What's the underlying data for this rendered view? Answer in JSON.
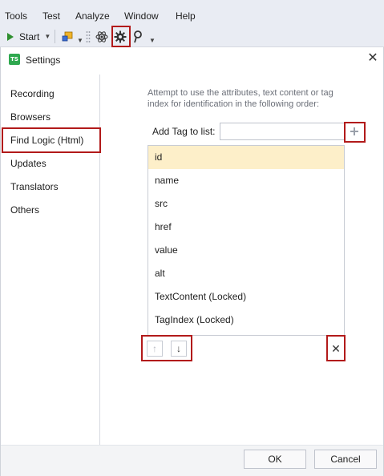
{
  "menu": {
    "items": [
      "Tools",
      "Test",
      "Analyze",
      "Window",
      "Help"
    ]
  },
  "toolbar": {
    "start_label": "Start"
  },
  "dialog": {
    "title": "Settings",
    "logo_text": "TS",
    "nav": [
      "Recording",
      "Browsers",
      "Find Logic (Html)",
      "Updates",
      "Translators",
      "Others"
    ],
    "selected_nav": "Find Logic (Html)",
    "description": "Attempt to use the attributes, text content or tag index for identification in the following order:",
    "add_tag_label": "Add Tag to list:",
    "add_tag_value": "",
    "tags": [
      "id",
      "name",
      "src",
      "href",
      "value",
      "alt",
      "TextContent (Locked)",
      "TagIndex (Locked)"
    ],
    "selected_tag": "id",
    "ok_label": "OK",
    "cancel_label": "Cancel"
  },
  "icons": {
    "start": "play-icon",
    "add": "plus-icon",
    "up": "arrow-up-icon",
    "down": "arrow-down-icon",
    "delete": "x-icon",
    "close": "close-icon",
    "settings": "gear-icon"
  },
  "colors": {
    "highlight": "#b21a1a",
    "selection": "#fdefc9",
    "play": "#2f8f2f",
    "logo": "#2fa84f"
  }
}
